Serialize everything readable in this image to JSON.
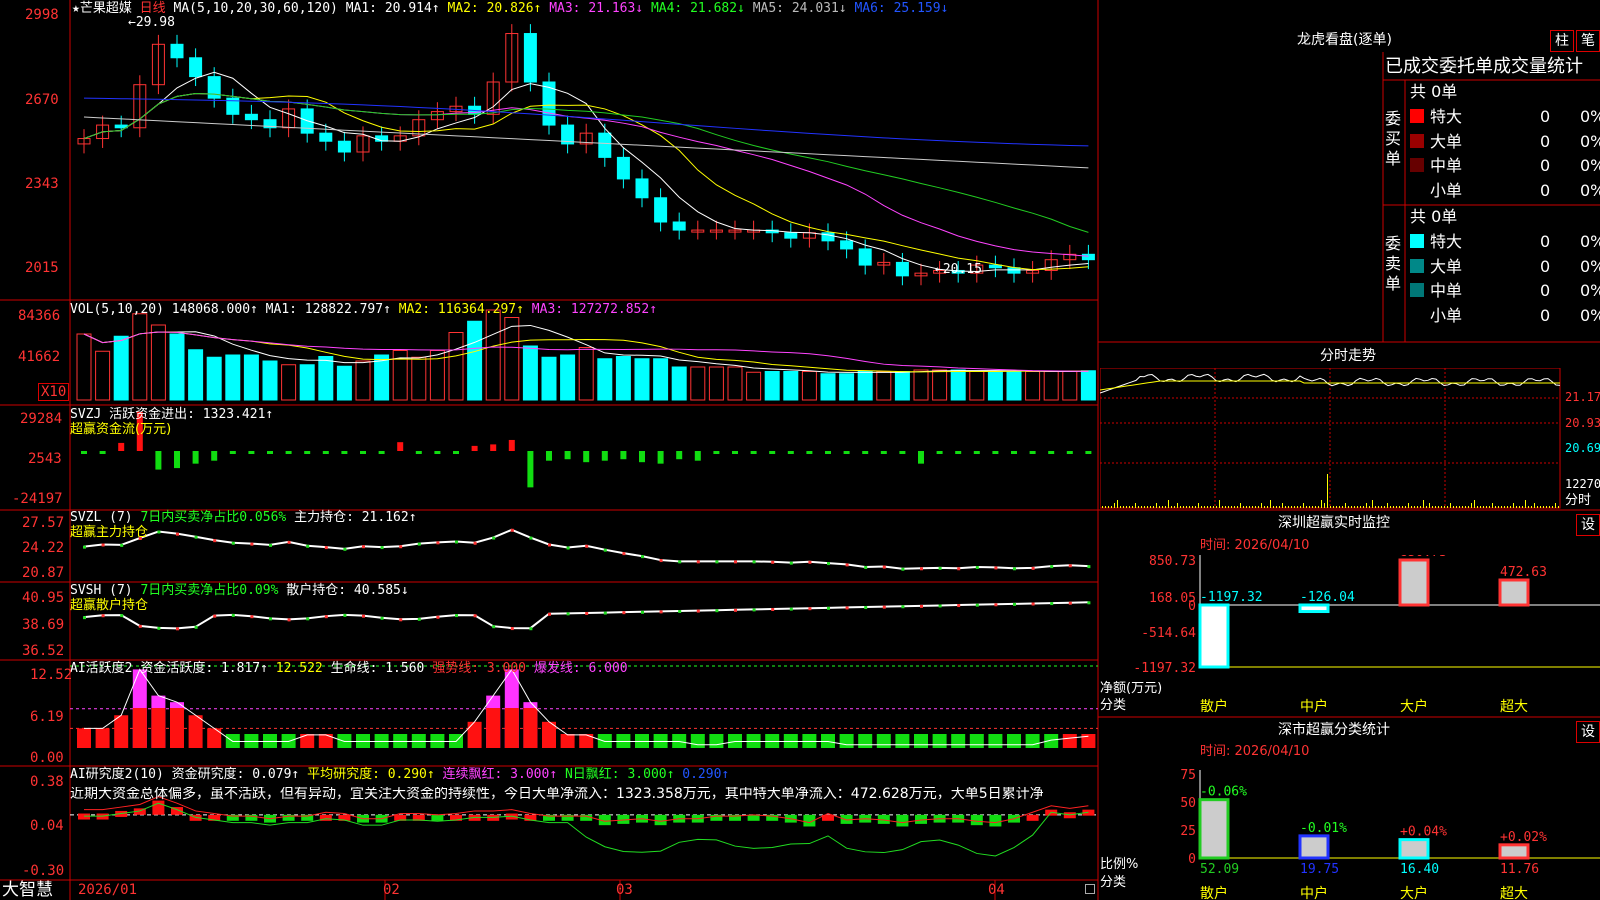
{
  "header": {
    "stock_name": "★芒果超媒",
    "period": "日线",
    "ma_label": "MA(5,10,20,30,60,120)",
    "ma1": "MA1: 20.914↑",
    "ma2": "MA2: 20.826↑",
    "ma3": "MA3: 21.163↓",
    "ma4": "MA4: 21.682↓",
    "ma5": "MA5: 24.031↓",
    "ma6": "MA6: 25.159↓",
    "high_marker": "←29.98",
    "low_marker": "←20.15"
  },
  "price_axis": [
    "2998",
    "2670",
    "2343",
    "2015"
  ],
  "vol": {
    "label": "VOL(5,10,20)",
    "value": "148068.000↑",
    "ma1": "MA1: 128822.797↑",
    "ma2": "MA2: 116364.297↑",
    "ma3": "MA3: 127272.852↑",
    "axis": [
      "84366",
      "41662"
    ],
    "unit": "X10"
  },
  "svzj": {
    "label": "SVZJ  活跃资金进出: 1323.421↑",
    "sub": "超赢资金流(万元)",
    "axis": [
      "29284",
      "2543",
      "-24197"
    ]
  },
  "svzl": {
    "label": "SVZL (7)",
    "pct": "7日内买卖净占比0.056%",
    "hold": "主力持仓: 21.162↑",
    "sub": "超赢主力持仓",
    "axis": [
      "27.57",
      "24.22",
      "20.87"
    ]
  },
  "svsh": {
    "label": "SVSH (7)",
    "pct": "7日内买卖净占比0.09%",
    "hold": "散户持仓: 40.585↓",
    "sub": "超赢散户持仓",
    "axis": [
      "40.95",
      "38.69",
      "36.52"
    ]
  },
  "ai1": {
    "label": "AI活跃度2",
    "v1": "资金活跃度: 1.817↑",
    "v2": "12.522",
    "v3": "生命线: 1.560",
    "v4": "强势线: 3.000",
    "v5": "爆发线: 6.000",
    "axis": [
      "12.52",
      "6.19",
      "0.00"
    ]
  },
  "ai2": {
    "label": "AI研究度2(10)",
    "v1": "资金研究度: 0.079↑",
    "v2": "平均研究度: 0.290↑",
    "v3": "连续飘红: 3.000↑",
    "v4": "N日飘红: 3.000↑",
    "v5": "0.290↑",
    "text": "近期大资金总体偏多，虽不活跃，但有异动，宜关注大资金的持续性，今日大单净流入：1323.358万元，其中特大单净流入：472.628万元，大单5日累计净",
    "axis": [
      "0.38",
      "0.04",
      "-0.30"
    ]
  },
  "time_axis": [
    "2026/01",
    "02",
    "03",
    "04"
  ],
  "brand": "大智慧",
  "lhb": {
    "title": "龙虎看盘(逐单)",
    "btn1": "柱",
    "btn2": "笔",
    "tabs": "已成交委托单成交量统计",
    "buy": {
      "side": "委买单",
      "total": "共 0单",
      "rows": [
        {
          "name": "特大",
          "count": "0",
          "pct": "0%",
          "color": "#ff0000"
        },
        {
          "name": "大单",
          "count": "0",
          "pct": "0%",
          "color": "#990000"
        },
        {
          "name": "中单",
          "count": "0",
          "pct": "0%",
          "color": "#660000"
        },
        {
          "name": "小单",
          "count": "0",
          "pct": "0%",
          "color": ""
        }
      ]
    },
    "sell": {
      "side": "委卖单",
      "total": "共 0单",
      "rows": [
        {
          "name": "特大",
          "count": "0",
          "pct": "0%",
          "color": "#00ffff"
        },
        {
          "name": "大单",
          "count": "0",
          "pct": "0%",
          "color": "#008888"
        },
        {
          "name": "中单",
          "count": "0",
          "pct": "0%",
          "color": "#007777"
        },
        {
          "name": "小单",
          "count": "0",
          "pct": "0%",
          "color": ""
        }
      ]
    }
  },
  "intraday": {
    "title": "分时走势",
    "axis": [
      "21.17",
      "20.93",
      "20.69",
      "12270"
    ],
    "unit": "分时"
  },
  "monitor": {
    "title": "深圳超赢实时监控",
    "btn": "设",
    "time": "时间: 2026/04/10",
    "axis": [
      "850.73",
      "168.05",
      "0",
      "-514.64",
      "-1197.32"
    ],
    "ylabel": "净额(万元)",
    "xlabel": "分类",
    "bars": [
      {
        "name": "散户",
        "value": "-1197.32",
        "num": -1197.32
      },
      {
        "name": "中户",
        "value": "-126.04",
        "num": -126.04
      },
      {
        "name": "大户",
        "value": "850.73",
        "num": 850.73
      },
      {
        "name": "超大",
        "value": "472.63",
        "num": 472.63
      }
    ]
  },
  "classify": {
    "title": "深市超赢分类统计",
    "btn": "设",
    "time": "时间: 2026/04/10",
    "axis": [
      "75",
      "50",
      "25",
      "0"
    ],
    "ylabel": "比例%",
    "xlabel": "分类",
    "bars": [
      {
        "name": "散户",
        "value": "52.09",
        "delta": "-0.06%",
        "num": 52.09
      },
      {
        "name": "中户",
        "value": "19.75",
        "delta": "-0.01%",
        "num": 19.75
      },
      {
        "name": "大户",
        "value": "16.40",
        "delta": "+0.04%",
        "num": 16.4
      },
      {
        "name": "超大",
        "value": "11.76",
        "delta": "+0.02%",
        "num": 11.76
      }
    ]
  },
  "colors": {
    "up": "#ff3333",
    "down": "#00ffff",
    "grid": "#cc0000",
    "ma1": "#ffffff",
    "ma2": "#ffff00",
    "ma3": "#ff44ff",
    "ma4": "#22cc22",
    "ma5": "#cccccc",
    "ma6": "#2233ff"
  },
  "chart_data": {
    "type": "candlestick",
    "close": [
      25.5,
      26.0,
      25.9,
      27.5,
      29.0,
      28.5,
      27.8,
      27.0,
      26.4,
      26.2,
      25.9,
      26.6,
      25.7,
      25.4,
      25.0,
      25.6,
      25.4,
      25.6,
      26.2,
      26.5,
      26.7,
      26.4,
      27.6,
      29.4,
      27.6,
      26.0,
      25.3,
      25.7,
      24.8,
      24.0,
      23.3,
      22.4,
      22.1,
      22.1,
      22.1,
      22.1,
      22.1,
      22.0,
      21.8,
      22.0,
      21.7,
      21.4,
      20.8,
      20.9,
      20.4,
      20.5,
      20.6,
      20.5,
      20.8,
      20.7,
      20.5,
      20.6,
      21.0,
      21.2,
      21.0
    ],
    "volume": [
      88000,
      65000,
      85000,
      115000,
      100000,
      88000,
      67000,
      57000,
      60000,
      60000,
      52000,
      47000,
      47000,
      58000,
      45000,
      52000,
      60000,
      66000,
      57000,
      66000,
      90000,
      105000,
      120000,
      110000,
      72000,
      57000,
      60000,
      70000,
      55000,
      58000,
      55000,
      55000,
      44000,
      44000,
      44000,
      44000,
      37000,
      38000,
      38000,
      38000,
      35000,
      35000,
      38000,
      38000,
      38000,
      40000,
      40000,
      40000,
      38000,
      38000,
      38000,
      38000,
      38000,
      38000,
      39000
    ],
    "flow": [
      2543,
      2543,
      8000,
      29000,
      -10000,
      -9000,
      -6000,
      -4000,
      2543,
      2543,
      2543,
      2543,
      2543,
      2543,
      2543,
      2543,
      2543,
      8500,
      2543,
      2543,
      2543,
      6000,
      7000,
      10000,
      -22000,
      -4000,
      -3000,
      -5000,
      -4000,
      -3000,
      -5000,
      -6000,
      -3000,
      -4000,
      2543,
      2543,
      2543,
      2543,
      2543,
      2543,
      2543,
      2543,
      2543,
      2543,
      2543,
      -6000,
      2543,
      2543,
      2543,
      2543,
      2543,
      2543,
      2543,
      2543,
      2543
    ],
    "ai_act": [
      3,
      3,
      5,
      12,
      8,
      7,
      5,
      3,
      1,
      1,
      1,
      1,
      2,
      2,
      1,
      1,
      1,
      1,
      1,
      1,
      1,
      4,
      8,
      12,
      7,
      4,
      2,
      2,
      1,
      1,
      1,
      1,
      1,
      0.5,
      0.5,
      1,
      1,
      1,
      1,
      1,
      1,
      0.5,
      0.5,
      0.5,
      0.5,
      0.5,
      0.5,
      0.5,
      0.5,
      0.5,
      0.5,
      0.5,
      1.2,
      1.5,
      1.8
    ],
    "ai_res": [
      0.05,
      0.05,
      0.07,
      0.09,
      0.15,
      0.1,
      0.04,
      0.02,
      0.0,
      0.0,
      -0.02,
      0.0,
      0.0,
      0.03,
      0.02,
      -0.02,
      -0.02,
      0.02,
      0.02,
      0.01,
      0.02,
      0.04,
      0.04,
      0.05,
      0.02,
      0.0,
      0.0,
      0.0,
      -0.04,
      -0.03,
      -0.02,
      -0.04,
      -0.02,
      -0.02,
      0.0,
      0.0,
      0.01,
      0.0,
      -0.02,
      -0.05,
      0.02,
      -0.03,
      -0.02,
      -0.03,
      -0.05,
      -0.03,
      -0.02,
      -0.02,
      -0.04,
      -0.05,
      -0.02,
      0.03,
      0.08,
      0.06,
      0.08
    ]
  }
}
